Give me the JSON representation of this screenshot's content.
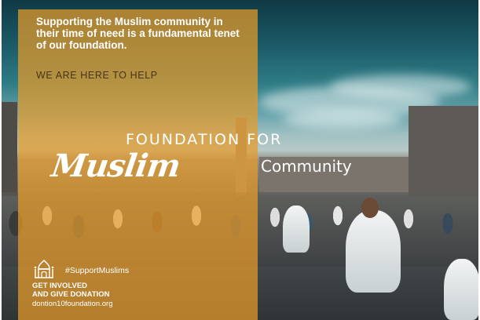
{
  "poster": {
    "mission_text": "Supporting the Muslim community in their time of need is a fundamental tenet of our foundation.",
    "tagline": "WE ARE HERE TO HELP",
    "headline_top": "FOUNDATION FOR",
    "headline_script": "Muslim",
    "headline_end": "Community",
    "hashtag": "#SupportMuslims",
    "cta_line_1": "GET INVOLVED",
    "cta_line_2": "AND GIVE DONATION",
    "website": "dontion10foundation.org"
  },
  "colors": {
    "panel_overlay": "#e89b2a",
    "tagline_text": "#4a3412",
    "text_primary": "#ffffff",
    "sky_teal": "#1b5a66"
  },
  "icons": {
    "logo": "mosque-logo-icon"
  }
}
